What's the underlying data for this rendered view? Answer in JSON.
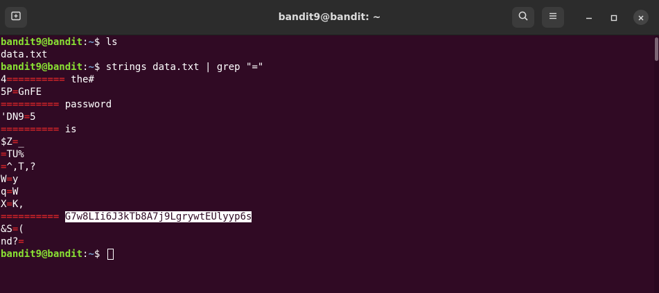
{
  "window": {
    "title": "bandit9@bandit: ~"
  },
  "prompt": {
    "user": "bandit9@bandit",
    "colon": ":",
    "path": "~",
    "dollar": "$ "
  },
  "commands": {
    "cmd1": "ls",
    "cmd2": "strings data.txt | grep \"=\""
  },
  "output": {
    "ls_result": "data.txt",
    "l1": {
      "a": "4",
      "b": "==========",
      "c": " the#"
    },
    "l2": {
      "a": "5P",
      "b": "=",
      "c": "GnFE"
    },
    "l3": {
      "b": "==========",
      "c": " password"
    },
    "l4": {
      "a": "'DN9",
      "b": "=",
      "c": "5"
    },
    "l5": {
      "b": "==========",
      "c": " is"
    },
    "l6": {
      "a": "$Z",
      "b": "=",
      "c": "_"
    },
    "l7": {
      "b": "=",
      "c": "TU%"
    },
    "l8": {
      "b": "=",
      "c": "^,T,?"
    },
    "l9": {
      "a": "W",
      "b": "=",
      "c": "y"
    },
    "l10": {
      "a": "q",
      "b": "=",
      "c": "W"
    },
    "l11": {
      "a": "X",
      "b": "=",
      "c": "K,"
    },
    "l12": {
      "b": "==========",
      "sp": " ",
      "c": "G7w8LIi6J3kTb8A7j9LgrywtEUlyyp6s"
    },
    "l13": {
      "a": "&S",
      "b": "=",
      "c": "("
    },
    "l14": {
      "a": "nd?",
      "b": "="
    }
  },
  "icons": {
    "new_tab": "new-tab-icon",
    "search": "search-icon",
    "menu": "hamburger-menu-icon",
    "minimize": "minimize-icon",
    "maximize": "maximize-icon",
    "close": "close-icon"
  },
  "colors": {
    "background": "#300a24",
    "prompt_user": "#8ae234",
    "prompt_path": "#729fcf",
    "match": "#ef2929",
    "text": "#ffffff"
  }
}
